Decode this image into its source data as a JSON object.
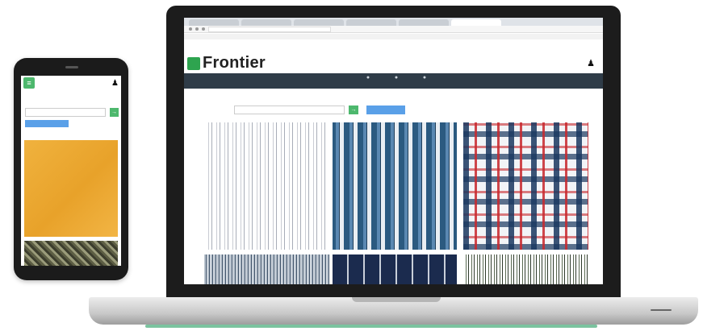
{
  "laptop": {
    "browser_tabs": [
      "",
      "",
      "",
      "",
      "",
      ""
    ],
    "brand": "Frontier",
    "nav": [
      {
        "label": "",
        "icon": "home-icon"
      },
      {
        "label": "",
        "icon": "search-icon"
      },
      {
        "label": "",
        "icon": "gear-icon"
      }
    ],
    "section_title": "",
    "field_label": "",
    "select_value": "",
    "go_label": "→",
    "search_button": "",
    "swatches": [
      {
        "name": "white-pinstripe-swatch"
      },
      {
        "name": "blue-stripe-swatch"
      },
      {
        "name": "plaid-swatch"
      },
      {
        "name": "fine-stripe-swatch"
      },
      {
        "name": "navy-stripe-swatch"
      },
      {
        "name": "green-stripe-swatch"
      }
    ]
  },
  "phone": {
    "menu_icon": "menu-icon",
    "user_icon": "user-icon",
    "section_title": "",
    "field_label": "",
    "select_value": "",
    "go_label": "→",
    "search_button": ""
  },
  "colors": {
    "brand_green": "#2ea44f",
    "nav_bar": "#2f3c48",
    "button_blue": "#5aa0e8",
    "accent_red": "#e05050"
  }
}
